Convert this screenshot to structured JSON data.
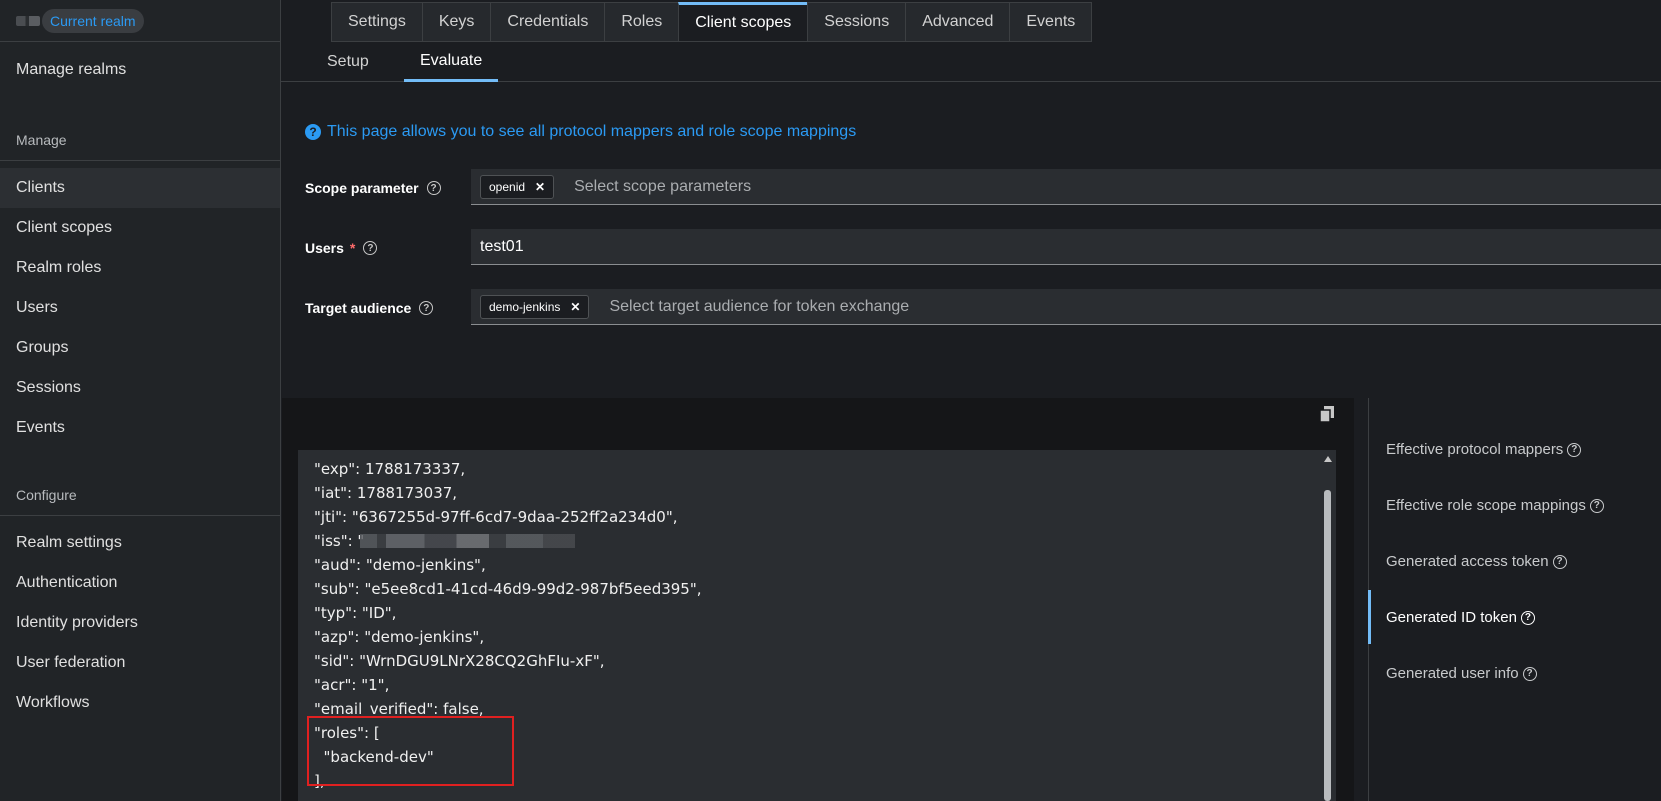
{
  "sidebar": {
    "realm_badge": "Current realm",
    "manage_realms": "Manage realms",
    "section_manage": "Manage",
    "manage_items": [
      "Clients",
      "Client scopes",
      "Realm roles",
      "Users",
      "Groups",
      "Sessions",
      "Events"
    ],
    "section_configure": "Configure",
    "configure_items": [
      "Realm settings",
      "Authentication",
      "Identity providers",
      "User federation",
      "Workflows"
    ]
  },
  "tabs": [
    "Settings",
    "Keys",
    "Credentials",
    "Roles",
    "Client scopes",
    "Sessions",
    "Advanced",
    "Events"
  ],
  "subtabs": [
    "Setup",
    "Evaluate"
  ],
  "info_text": "This page allows you to see all protocol mappers and role scope mappings",
  "form": {
    "scope_label": "Scope parameter",
    "scope_chip": "openid",
    "scope_placeholder": "Select scope parameters",
    "users_label": "Users",
    "users_required": "*",
    "users_value": "test01",
    "audience_label": "Target audience",
    "audience_chip": "demo-jenkins",
    "audience_placeholder": "Select target audience for token exchange"
  },
  "code_lines": [
    "\"exp\": 1788173337,",
    "\"iat\": 1788173037,",
    "\"jti\": \"6367255d-97ff-6cd7-9daa-252ff2a234d0\",",
    "\"iss\": \"",
    "\"aud\": \"demo-jenkins\",",
    "\"sub\": \"e5ee8cd1-41cd-46d9-99d2-987bf5eed395\",",
    "\"typ\": \"ID\",",
    "\"azp\": \"demo-jenkins\",",
    "\"sid\": \"WrnDGU9LNrX28CQ2GhFIu-xF\",",
    "\"acr\": \"1\",",
    "\"email_verified\": false,",
    "\"roles\": [",
    "  \"backend-dev\"",
    "],"
  ],
  "right_panel": [
    "Effective protocol mappers",
    "Effective role scope mappings",
    "Generated access token",
    "Generated ID token",
    "Generated user info"
  ],
  "icons": {
    "help": "?",
    "close": "✕"
  },
  "colors": {
    "accent": "#73bcf7",
    "link": "#2b9af3",
    "highlight": "#e02020"
  }
}
